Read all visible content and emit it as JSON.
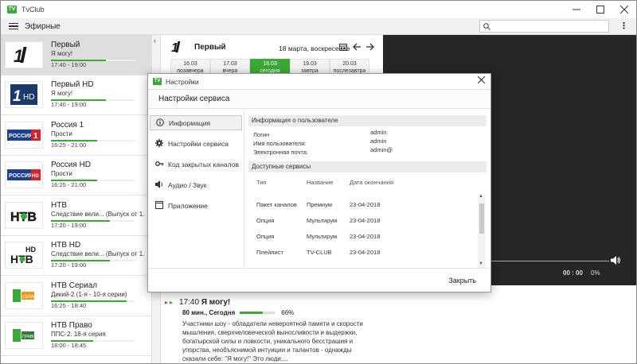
{
  "window": {
    "title": "TvClub",
    "logo_text": "TV"
  },
  "toolbar": {
    "section": "Эфирные",
    "search_placeholder": ""
  },
  "colors": {
    "accent": "#3aa935",
    "player_bg": "#262626"
  },
  "channels": [
    {
      "name": "Первый",
      "program": "Я могу!",
      "time": "17:40 - 19:00",
      "progress": 0.66,
      "logo": "ch1-logo"
    },
    {
      "name": "Первый HD",
      "program": "Я могу!",
      "time": "17:40 - 19:00",
      "progress": 0.66,
      "logo": "ch1hd-logo"
    },
    {
      "name": "Россия 1",
      "program": "Прости",
      "time": "16:25 - 21:00",
      "progress": 0.55,
      "logo": "russia1-logo"
    },
    {
      "name": "Россия HD",
      "program": "Прости",
      "time": "16:25 - 21:00",
      "progress": 0.55,
      "logo": "russiahd-logo"
    },
    {
      "name": "НТВ",
      "program": "Следствие вели... (Выпуск от 1...",
      "time": "17:20 - 19:00",
      "progress": 0.7,
      "logo": "ntv-logo"
    },
    {
      "name": "НТВ HD",
      "program": "Следствие вели... (Выпуск от 1...",
      "time": "17:20 - 19:00",
      "progress": 0.7,
      "logo": "ntvhd-logo"
    },
    {
      "name": "НТВ Сериал",
      "program": "Дикий-2 (1-я - 10-я серии)",
      "time": "16:25 - 18:40",
      "progress": 0.9,
      "logo": "ntvserial-logo"
    },
    {
      "name": "НТВ Право",
      "program": "ППС-2. 18-я серия",
      "time": "18:00 - 18:45",
      "progress": 0.5,
      "logo": "ntvpravo-logo"
    }
  ],
  "epg": {
    "channel": "Первый",
    "date": "18 марта, воскресенье",
    "days": [
      {
        "date": "16.03",
        "label": "позавчера"
      },
      {
        "date": "17.03",
        "label": "вчера"
      },
      {
        "date": "18.03",
        "label": "сегодня"
      },
      {
        "date": "19.03",
        "label": "завтра"
      },
      {
        "date": "20.03",
        "label": "послезавтра"
      }
    ],
    "current": {
      "time": "17:40",
      "title": "Я могу!",
      "sub": "80 мин., Сегодня",
      "progress": 0.66,
      "progress_label": "66%",
      "description": "Участники шоу - обладатели невероятной памяти и скорости мышления, сверхчеловеческой выносливости и выдержки, богатырской силы и ловкости, уникального бесстрашия и упорства, необъяснимой интуиции и талантов - однажды сказали себе: \"Я могу!\" Это люди,..."
    }
  },
  "player": {
    "time": "00 : 00",
    "percent": "0%"
  },
  "dialog": {
    "window_title": "Настройки",
    "header": "Настройки сервиса",
    "nav": [
      {
        "label": "Информация",
        "icon": "info-icon"
      },
      {
        "label": "Настройки сервиса",
        "icon": "gear-icon"
      },
      {
        "label": "Код закрытых каналов",
        "icon": "key-icon"
      },
      {
        "label": "Аудио / Звук",
        "icon": "speaker-icon"
      },
      {
        "label": "Приложение",
        "icon": "window-icon"
      }
    ],
    "user_info_title": "Информация о пользователе",
    "user_info": [
      {
        "key": "Логин",
        "value": "admin"
      },
      {
        "key": "Имя пользователя:",
        "value": "admin"
      },
      {
        "key": "Электронная почта:",
        "value": "admin@"
      }
    ],
    "services_title": "Доступные сервисы",
    "services_headers": [
      "Тип",
      "Название",
      "Дата окончания"
    ],
    "services": [
      {
        "type": "Пакет каналов",
        "name": "Премиум",
        "date": "23-04-2018"
      },
      {
        "type": "Опция",
        "name": "Мультирум",
        "date": "23-04-2018"
      },
      {
        "type": "Опция",
        "name": "Мультирум",
        "date": "23-04-2018"
      },
      {
        "type": "Плейлист",
        "name": "TV-CLUB",
        "date": "23-04-2018"
      }
    ],
    "close_button": "Закрыть"
  }
}
